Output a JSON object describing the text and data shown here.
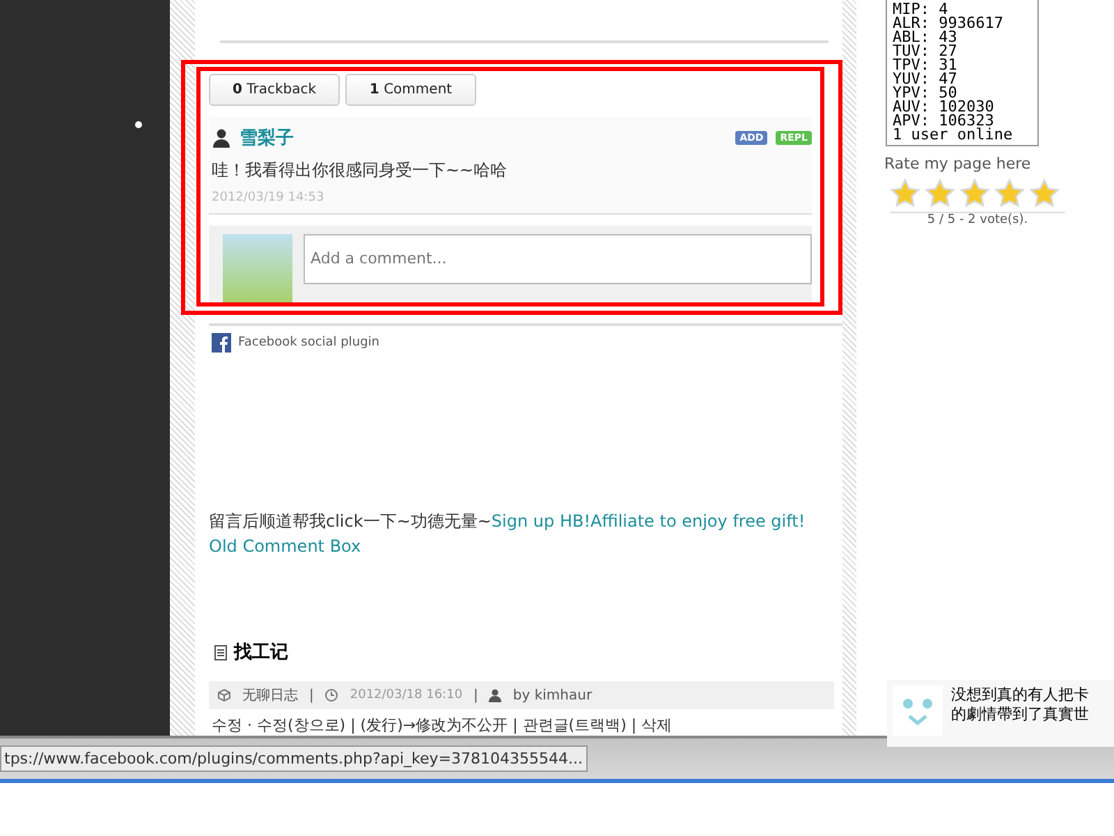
{
  "comment_tabs": [
    {
      "count": "0",
      "label": "Trackback"
    },
    {
      "count": "1",
      "label": "Comment"
    }
  ],
  "comments": [
    {
      "author": "雪梨子",
      "text": "哇！我看得出你很感同身受一下~~哈哈",
      "time": "2012/03/19 14:53",
      "badges": [
        "ADD",
        "REPL"
      ]
    }
  ],
  "composer": {
    "placeholder": "Add a comment..."
  },
  "plugin_credit": "Facebook social plugin",
  "promo": {
    "text": "留言后顺道帮我click一下~功德无量~",
    "links": [
      "Sign up HB!Affiliate to enjoy free gift!",
      "Old Comment Box"
    ]
  },
  "post": {
    "title": "找工记",
    "category": "无聊日志",
    "time": "2012/03/18 16:10",
    "author": "by kimhaur",
    "separator": "|",
    "actions": "수정 · 수정(창으로) | (发行)→修改为不公开 | 관련글(트랙백) | 삭제"
  },
  "stats_box": {
    "lines": [
      "MIP: 4",
      "ALR: 9936617",
      "ABL: 43",
      "TUV: 27",
      "TPV: 31",
      "YUV: 47",
      "YPV: 50",
      "AUV: 102030",
      "APV: 106323",
      "1 user online"
    ]
  },
  "rating": {
    "label": "Rate my page here",
    "stars": 5,
    "summary": "5 / 5 - 2 vote(s)."
  },
  "sidebar_comment": {
    "lines": [
      "没想到真的有人把卡",
      "的劇情帶到了真實世"
    ]
  },
  "status_bar": {
    "url": "tps://www.facebook.com/plugins/comments.php?api_key=378104355544..."
  }
}
